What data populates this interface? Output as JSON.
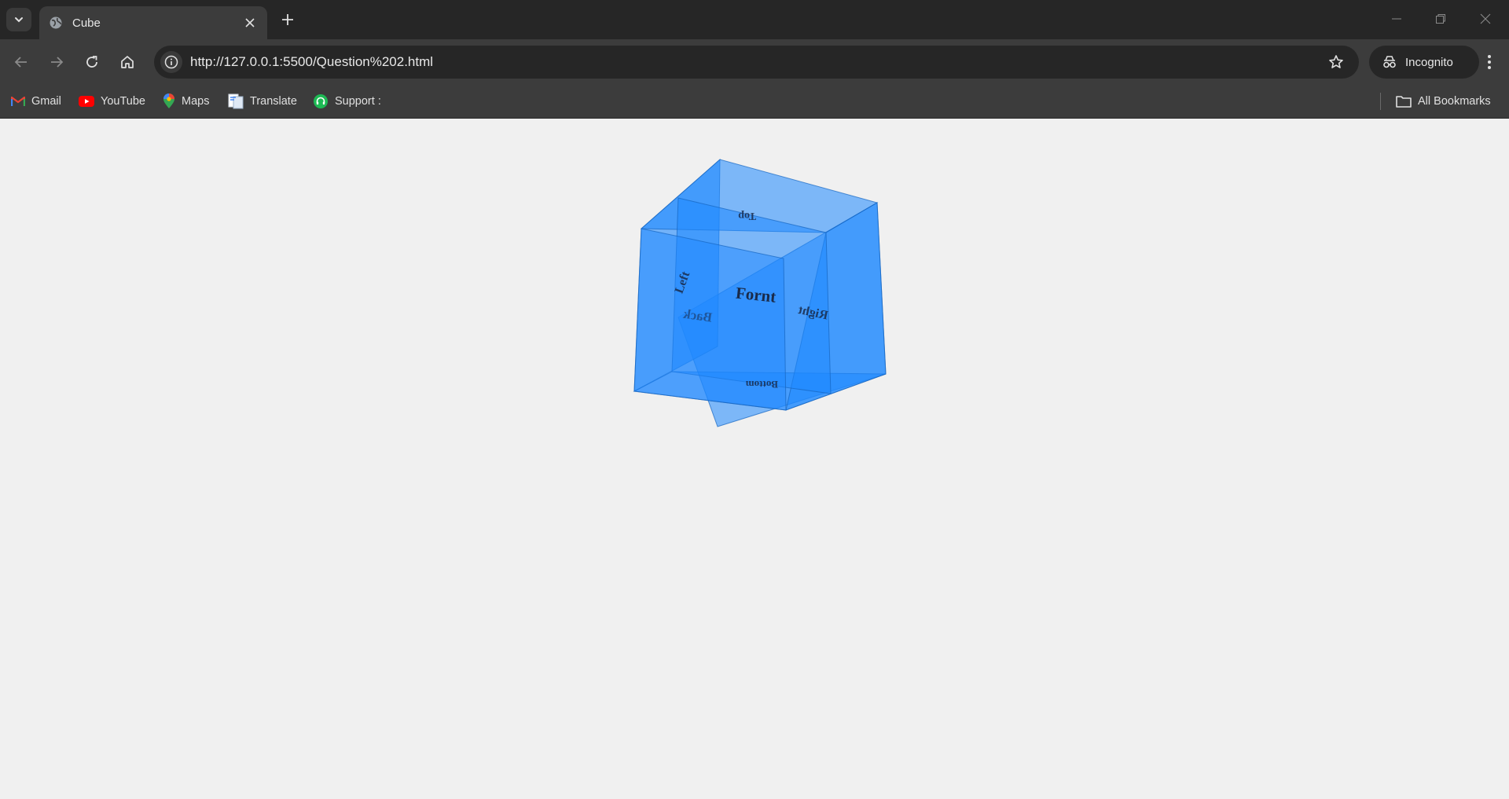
{
  "browser": {
    "tab": {
      "title": "Cube",
      "favicon": "globe-icon"
    },
    "url": "http://127.0.0.1:5500/Question%202.html",
    "incognito_label": "Incognito",
    "bookmarks": [
      {
        "label": "Gmail",
        "icon": "gmail-icon"
      },
      {
        "label": "YouTube",
        "icon": "youtube-icon"
      },
      {
        "label": "Maps",
        "icon": "maps-icon"
      },
      {
        "label": "Translate",
        "icon": "translate-icon"
      },
      {
        "label": "Support :",
        "icon": "support-icon"
      }
    ],
    "all_bookmarks_label": "All Bookmarks"
  },
  "cube": {
    "faces": {
      "front": "Fornt",
      "back": "Back",
      "left": "Left",
      "right": "Right",
      "top": "Top",
      "bottom": "Bottom"
    },
    "color": "#1e88ff"
  }
}
